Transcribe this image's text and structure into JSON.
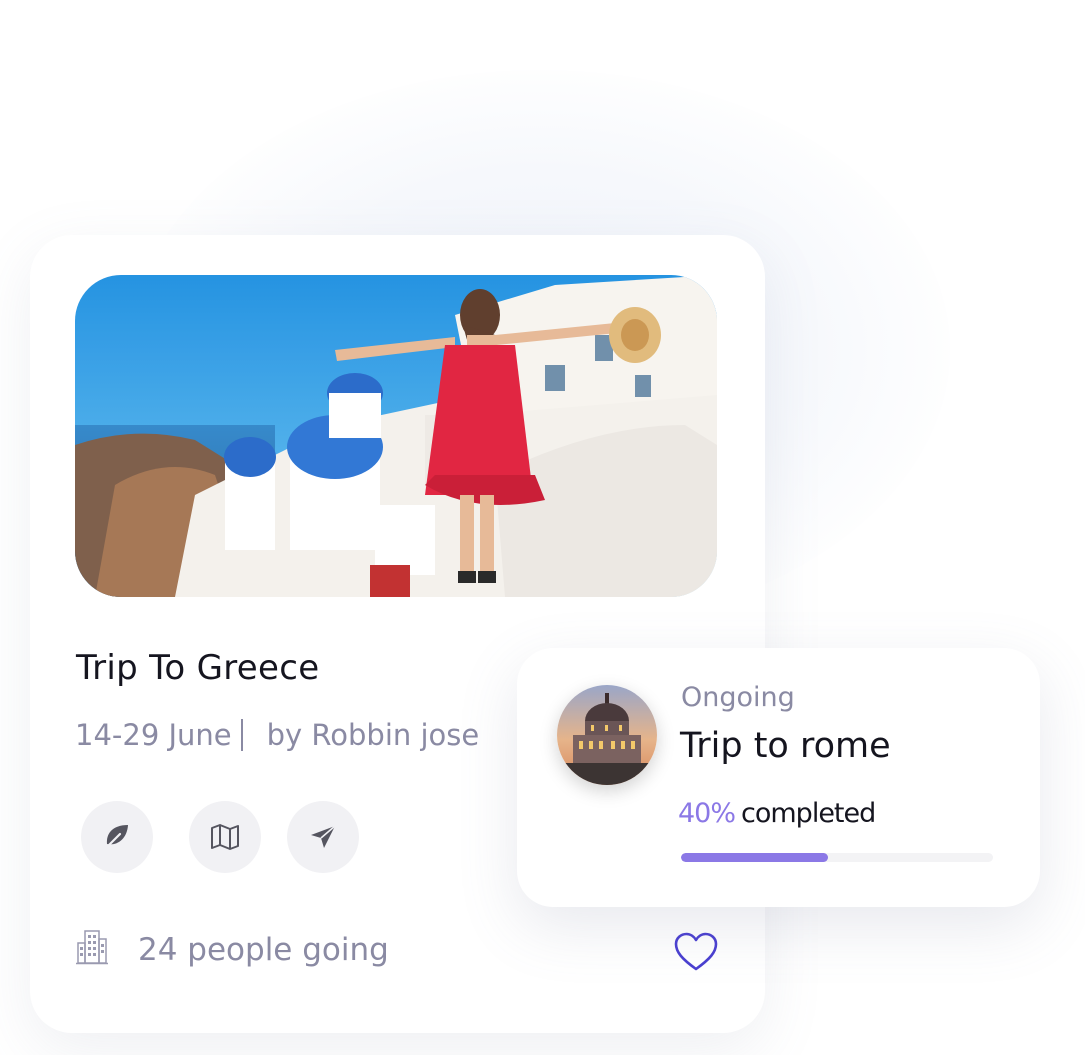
{
  "trip_card": {
    "title": "Trip To Greece",
    "dates": "14-29 June",
    "author": "by Robbin jose",
    "actions": [
      {
        "icon": "leaf-icon"
      },
      {
        "icon": "map-icon"
      },
      {
        "icon": "send-icon"
      }
    ],
    "footer": {
      "building_icon": "building-icon",
      "people_going": "24 people going",
      "favorite_icon": "heart-icon"
    }
  },
  "ongoing_card": {
    "status": "Ongoing",
    "title": "Trip to rome",
    "progress": {
      "percent_label": "40%",
      "completed_label": "completed",
      "value": 0.47
    }
  },
  "colors": {
    "accent": "#8b78e6",
    "text_dark": "#15151f",
    "text_muted": "#8a8aa3",
    "heart": "#4a3fd1"
  }
}
